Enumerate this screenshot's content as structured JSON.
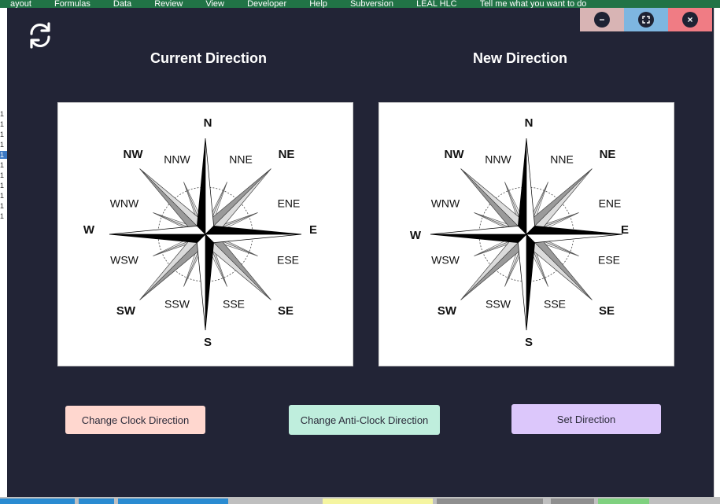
{
  "ribbon": {
    "tabs": [
      "ayout",
      "Formulas",
      "Data",
      "Review",
      "View",
      "Developer",
      "Help",
      "Subversion",
      "LEAL HLC"
    ],
    "tell_me": "Tell me what you want to do"
  },
  "sheet_rows": [
    "1",
    "1",
    "1",
    "1",
    "1",
    "1",
    "1",
    "1",
    "1",
    "1",
    "1"
  ],
  "dialog": {
    "current_title": "Current Direction",
    "new_title": "New Direction",
    "buttons": {
      "clockwise": "Change Clock Direction",
      "anticlockwise": "Change Anti-Clock Direction",
      "set": "Set Direction"
    },
    "window_controls": {
      "minimize": "−",
      "maximize": "⛶",
      "close": "×"
    }
  },
  "compass": {
    "labels": {
      "N": "N",
      "NNE": "NNE",
      "NE": "NE",
      "ENE": "ENE",
      "E": "E",
      "ESE": "ESE",
      "SE": "SE",
      "SSE": "SSE",
      "S": "S",
      "SSW": "SSW",
      "SW": "SW",
      "WSW": "WSW",
      "W": "W",
      "WNW": "WNW",
      "NW": "NW",
      "NNW": "NNW"
    }
  },
  "icons": {
    "refresh": "refresh-icon",
    "minimize": "minus-icon",
    "maximize": "maximize-icon",
    "close": "close-icon"
  },
  "colors": {
    "dialog_bg": "#222436",
    "minimize_bg": "#d8b4b4",
    "maximize_bg": "#7eb6e0",
    "close_bg": "#f07c84",
    "clockwise_btn": "#ffd7cf",
    "anticlockwise_btn": "#bfeedd",
    "set_btn": "#dcc7fb"
  }
}
